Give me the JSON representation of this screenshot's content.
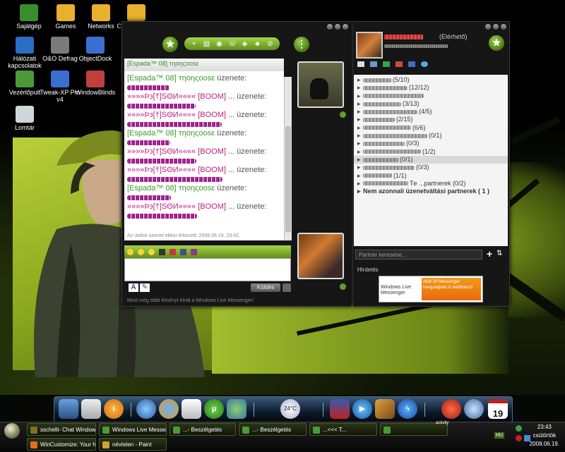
{
  "desktop": {
    "icons": [
      {
        "label": "Sajátgép",
        "color": "#3a8d2e"
      },
      {
        "label": "Games",
        "color": "#e8b02c"
      },
      {
        "label": "Networks",
        "color": "#e8b02c"
      },
      {
        "label": "Cd-DvD Tools",
        "color": "#e8b02c"
      },
      {
        "label": "Hálózati kapcsolatok",
        "color": "#2b6cc4"
      },
      {
        "label": "O&O Defrag",
        "color": "#7a7a7a"
      },
      {
        "label": "ObjectDock",
        "color": "#3a6fd0"
      },
      {
        "label": "Vezérlőpult",
        "color": "#4a9a3a"
      },
      {
        "label": "Tweak-XP Pro v4",
        "color": "#3a6fd0"
      },
      {
        "label": "WindowBlinds",
        "color": "#c04040"
      },
      {
        "label": "Lomtár",
        "color": "#cfd8d8"
      }
    ]
  },
  "chat": {
    "header_name": "[Espada™ 08] тηоηςооsε",
    "messages": [
      {
        "name": "[Espada™ 08] тηоηςооsε",
        "suffix": "üzenete:"
      },
      {
        "name": "»»»»Þ϶[†]SΘИ«««« [BOOM]",
        "suffix": "... üzenete:"
      },
      {
        "name": "»»»»Þ϶[†]SΘИ«««« [BOOM]",
        "suffix": "... üzenete:"
      },
      {
        "name": "[Espada™ 08] тηоηςооsε",
        "suffix": "üzenete:"
      },
      {
        "name": "»»»»Þ϶[†]SΘИ«««« [BOOM]",
        "suffix": "... üzenete:"
      },
      {
        "name": "»»»»Þ϶[†]SΘИ«««« [BOOM]",
        "suffix": "... üzenete:"
      },
      {
        "name": "[Espada™ 08] тηоηςооsε",
        "suffix": "üzenete:"
      },
      {
        "name": "»»»»Þ϶[†]SΘИ«««« [BOOM]",
        "suffix": "... üzenete:"
      }
    ],
    "last_message": "Az utolsó üzenet ekkor érkezett: 2008.06.19. 23:42.",
    "send_label": "Küldés",
    "promo": "Most még több élményt kínál a Windows Live Messenger!"
  },
  "contacts": {
    "status": "(Elérhető)",
    "groups": [
      {
        "label": "(5/10)"
      },
      {
        "label": "(12/12)"
      },
      {
        "label": ""
      },
      {
        "label": "(3/13)"
      },
      {
        "label": "(4/5)"
      },
      {
        "label": "(2/15)"
      },
      {
        "label": "(6/6)"
      },
      {
        "label": "(0/1)"
      },
      {
        "label": "(0/3)"
      },
      {
        "label": "(1/2)"
      },
      {
        "label": "(0/1)"
      },
      {
        "label": "(0/3)"
      },
      {
        "label": "(1/1)"
      },
      {
        "label": "Tе ...partnerek (0/2)"
      }
    ],
    "other_group": "Nem azonnali üzenetváltási partnerek ( 1 )",
    "search_placeholder": "Partner keresése...",
    "ad_label": "Hirdetés",
    "ad_logo": "Windows Live Messenger",
    "ad_text": "Akár 30 Messenger hangulatjelet is letölthetsz!"
  },
  "dock": {
    "weather": "24°C",
    "calendar_day": "19"
  },
  "taskbar": {
    "buttons_row1": [
      {
        "label": "sschelli- Chat Window",
        "color": "#8a6a2a"
      },
      {
        "label": "Windows Live Messen...",
        "color": "#4a9a3a"
      },
      {
        "label": "...- Beszélgetés",
        "color": "#4a9a3a"
      },
      {
        "label": "...- Beszélgetés",
        "color": "#4a9a3a"
      },
      {
        "label": "...<<< T...",
        "color": "#4a9a3a"
      },
      {
        "label": "",
        "color": "#4a9a3a"
      }
    ],
    "buttons_row2": [
      {
        "label": "WinCustomize: Your h...",
        "color": "#e07020"
      },
      {
        "label": "névtelen - Paint",
        "color": "#d0a030"
      }
    ],
    "activity": "activity",
    "lang": "HU",
    "time": "23:43",
    "day": "csütörtök",
    "date": "2008.06.19."
  }
}
